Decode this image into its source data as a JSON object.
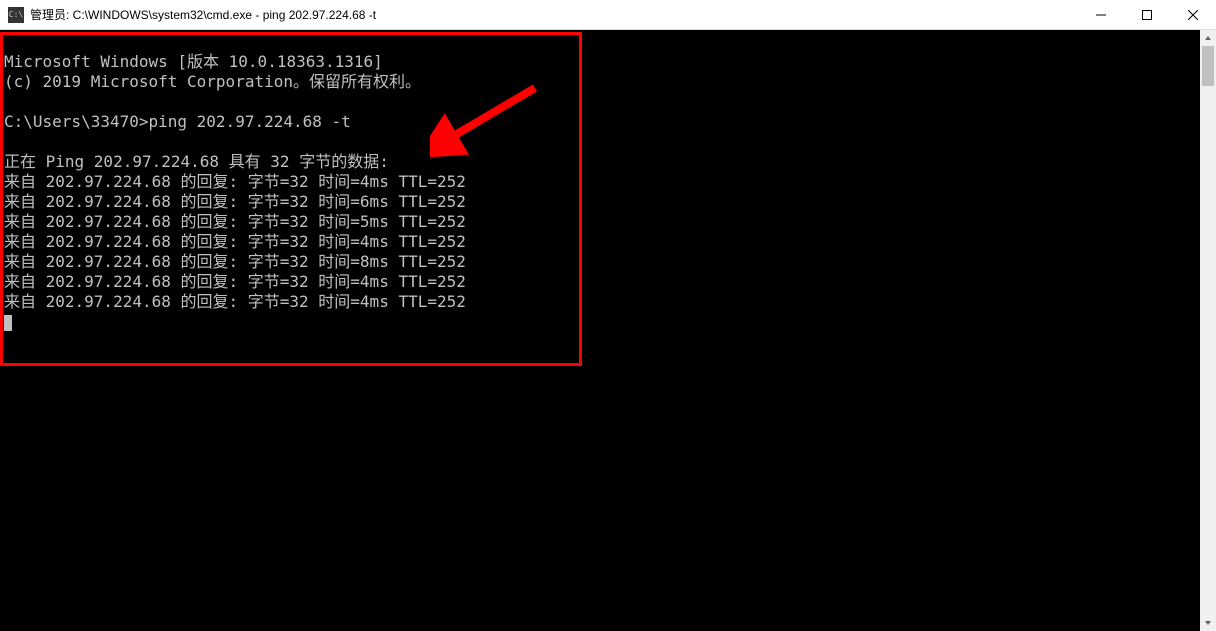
{
  "titlebar": {
    "icon_label": "cmd-icon",
    "title": "管理员: C:\\WINDOWS\\system32\\cmd.exe - ping  202.97.224.68 -t"
  },
  "console": {
    "version_line": "Microsoft Windows [版本 10.0.18363.1316]",
    "copyright_line": "(c) 2019 Microsoft Corporation。保留所有权利。",
    "blank": "",
    "prompt_line": "C:\\Users\\33470>ping 202.97.224.68 -t",
    "ping_header": "正在 Ping 202.97.224.68 具有 32 字节的数据:",
    "replies": [
      "来自 202.97.224.68 的回复: 字节=32 时间=4ms TTL=252",
      "来自 202.97.224.68 的回复: 字节=32 时间=6ms TTL=252",
      "来自 202.97.224.68 的回复: 字节=32 时间=5ms TTL=252",
      "来自 202.97.224.68 的回复: 字节=32 时间=4ms TTL=252",
      "来自 202.97.224.68 的回复: 字节=32 时间=8ms TTL=252",
      "来自 202.97.224.68 的回复: 字节=32 时间=4ms TTL=252",
      "来自 202.97.224.68 的回复: 字节=32 时间=4ms TTL=252"
    ]
  }
}
